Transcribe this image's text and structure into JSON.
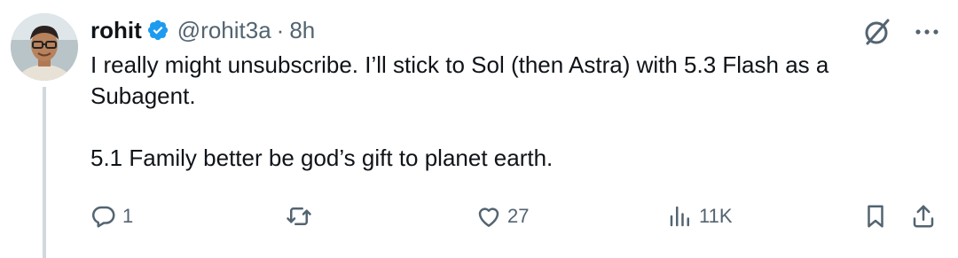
{
  "author": {
    "name": "rohit",
    "handle": "@rohit3a",
    "separator": "·",
    "time": "8h",
    "verified": true,
    "verified_color": "#1d9bf0"
  },
  "tweet": {
    "paragraphs": [
      "I really might unsubscribe. I’ll stick to Sol (then Astra) with 5.3 Flash as a Subagent.",
      "5.1 Family better be god’s gift to planet earth."
    ]
  },
  "header_icons": [
    "grok-icon",
    "more-icon"
  ],
  "actions": {
    "reply": {
      "icon": "reply-icon",
      "count": "1"
    },
    "retweet": {
      "icon": "retweet-icon",
      "count": ""
    },
    "like": {
      "icon": "heart-icon",
      "count": "27"
    },
    "views": {
      "icon": "views-icon",
      "count": "11K"
    },
    "bookmark": {
      "icon": "bookmark-icon"
    },
    "share": {
      "icon": "share-icon"
    }
  },
  "colors": {
    "text": "#0f1419",
    "secondary": "#536471",
    "thread_line": "#cfd9de"
  }
}
